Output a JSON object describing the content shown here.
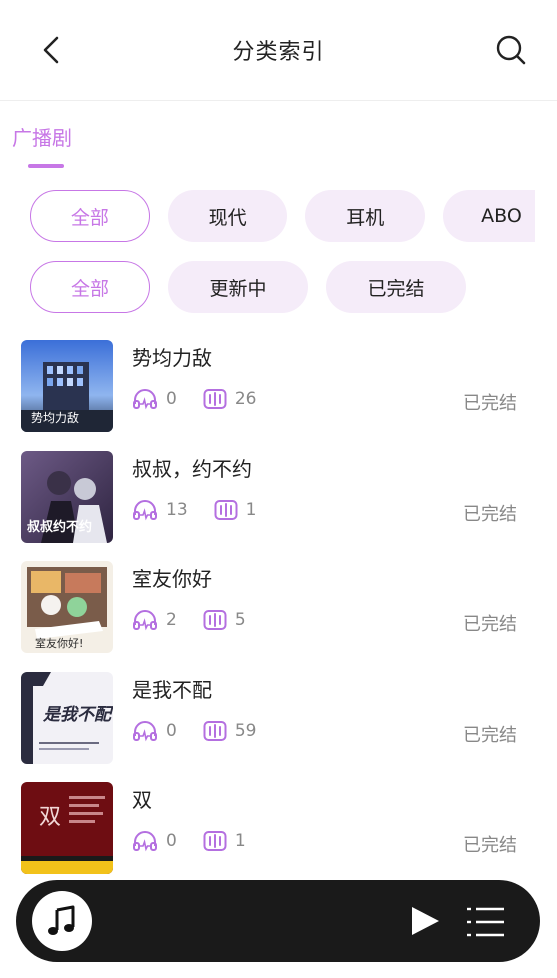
{
  "header": {
    "title": "分类索引",
    "back_icon": "chevron-left-icon",
    "search_icon": "search-icon"
  },
  "category_tab": {
    "label": "广播剧"
  },
  "filters": {
    "row1": [
      "全部",
      "现代",
      "耳机",
      "ABO"
    ],
    "row1_selected": "全部",
    "row2": [
      "全部",
      "更新中",
      "已完结"
    ],
    "row2_selected": "全部"
  },
  "items": [
    {
      "title": "势均力敌",
      "listens": "0",
      "episodes": "26",
      "status": "已完结",
      "cover_text": "势均力敌"
    },
    {
      "title": "叔叔，约不约",
      "listens": "13",
      "episodes": "1",
      "status": "已完结",
      "cover_text": "叔叔约不约"
    },
    {
      "title": "室友你好",
      "listens": "2",
      "episodes": "5",
      "status": "已完结",
      "cover_text": "室友你好!"
    },
    {
      "title": "是我不配",
      "listens": "0",
      "episodes": "59",
      "status": "已完结",
      "cover_text": "是我不配"
    },
    {
      "title": "双",
      "listens": "0",
      "episodes": "1",
      "status": "已完结",
      "cover_text": "双"
    }
  ],
  "player": {
    "disc_icon": "music-note-icon",
    "play_icon": "play-icon",
    "playlist_icon": "playlist-icon"
  },
  "colors": {
    "accent": "#c777e6",
    "chip_bg": "#f5ecf9",
    "player_bg": "#1a1a1a",
    "icon_purple": "#b46fe0"
  }
}
